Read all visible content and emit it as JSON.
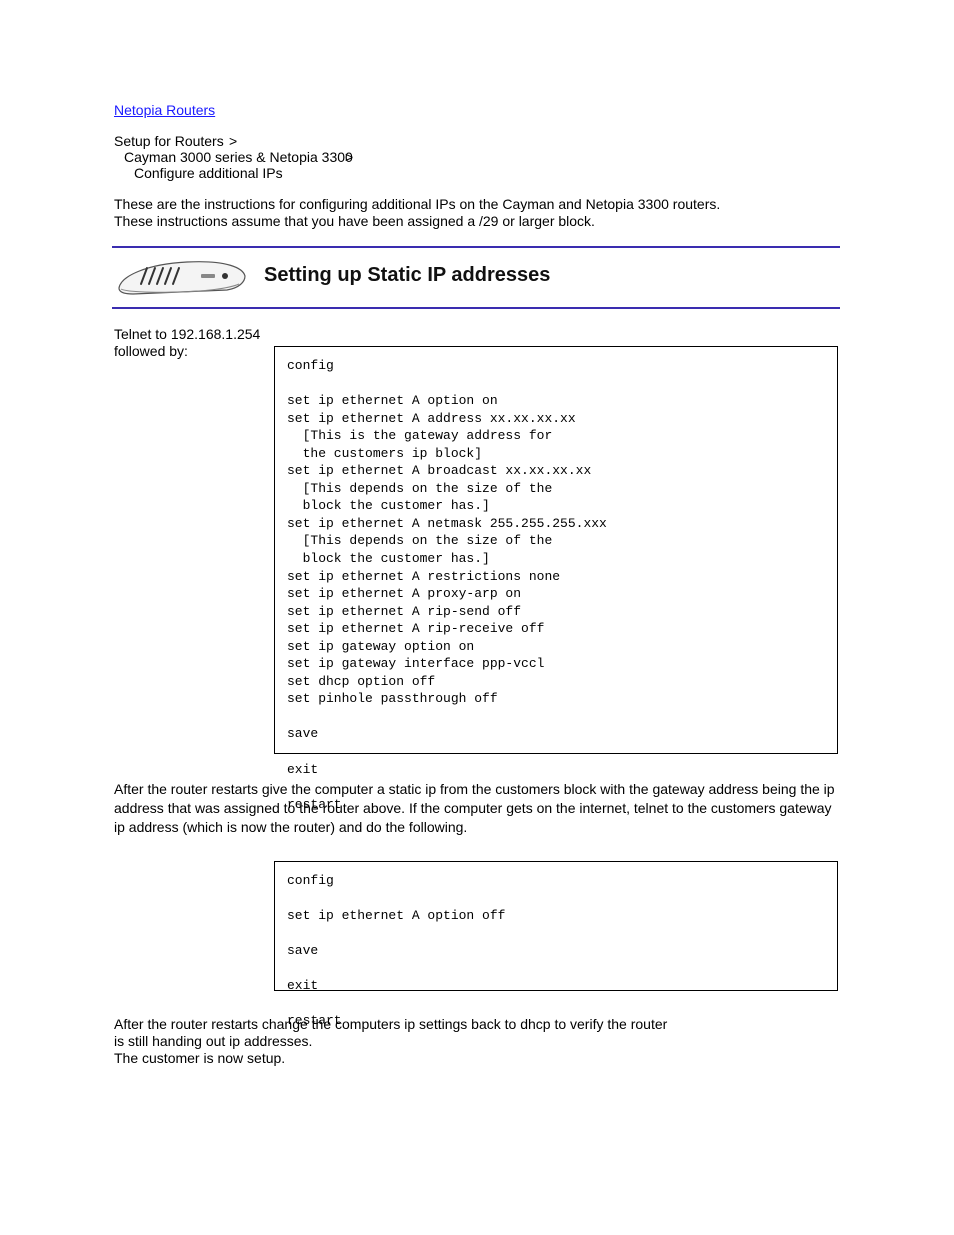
{
  "nav": {
    "top_link": "Netopia Routers",
    "bc1": "Setup for Routers",
    "sep": ">",
    "bc2": "Cayman 3000 series & Netopia 3300",
    "bc3": "Configure additional IPs"
  },
  "intro": {
    "l1": "These are the instructions for configuring additional IPs on the Cayman and Netopia 3300 routers.",
    "l2": "These instructions assume that you have been assigned a /29 or larger block."
  },
  "section": {
    "title": "Setting up Static IP addresses"
  },
  "para": {
    "l1": "Telnet to 192.168.1.254",
    "l2": "followed by:"
  },
  "box1_text": "config\n\nset ip ethernet A option on\nset ip ethernet A address xx.xx.xx.xx\n  [This is the gateway address for\n  the customers ip block]\nset ip ethernet A broadcast xx.xx.xx.xx\n  [This depends on the size of the\n  block the customer has.]\nset ip ethernet A netmask 255.255.255.xxx\n  [This depends on the size of the\n  block the customer has.]\nset ip ethernet A restrictions none\nset ip ethernet A proxy-arp on\nset ip ethernet A rip-send off\nset ip ethernet A rip-receive off\nset ip gateway option on\nset ip gateway interface ppp-vccl\nset dhcp option off\nset pinhole passthrough off\n\nsave\n\nexit\n\nrestart",
  "midtext": "After the router restarts give the computer a static ip from the customers block with the gateway address being the ip address that was assigned to the router above. If the computer gets on the internet, telnet to the customers gateway ip address (which is now the router) and do the following.",
  "box2_text": "config\n\nset ip ethernet A option off\n\nsave\n\nexit\n\nrestart",
  "tail": {
    "l1": "After the router restarts change the computers ip settings back to dhcp to verify the router",
    "l2": "is still handing out ip addresses.",
    "l3": "The customer is now setup."
  }
}
